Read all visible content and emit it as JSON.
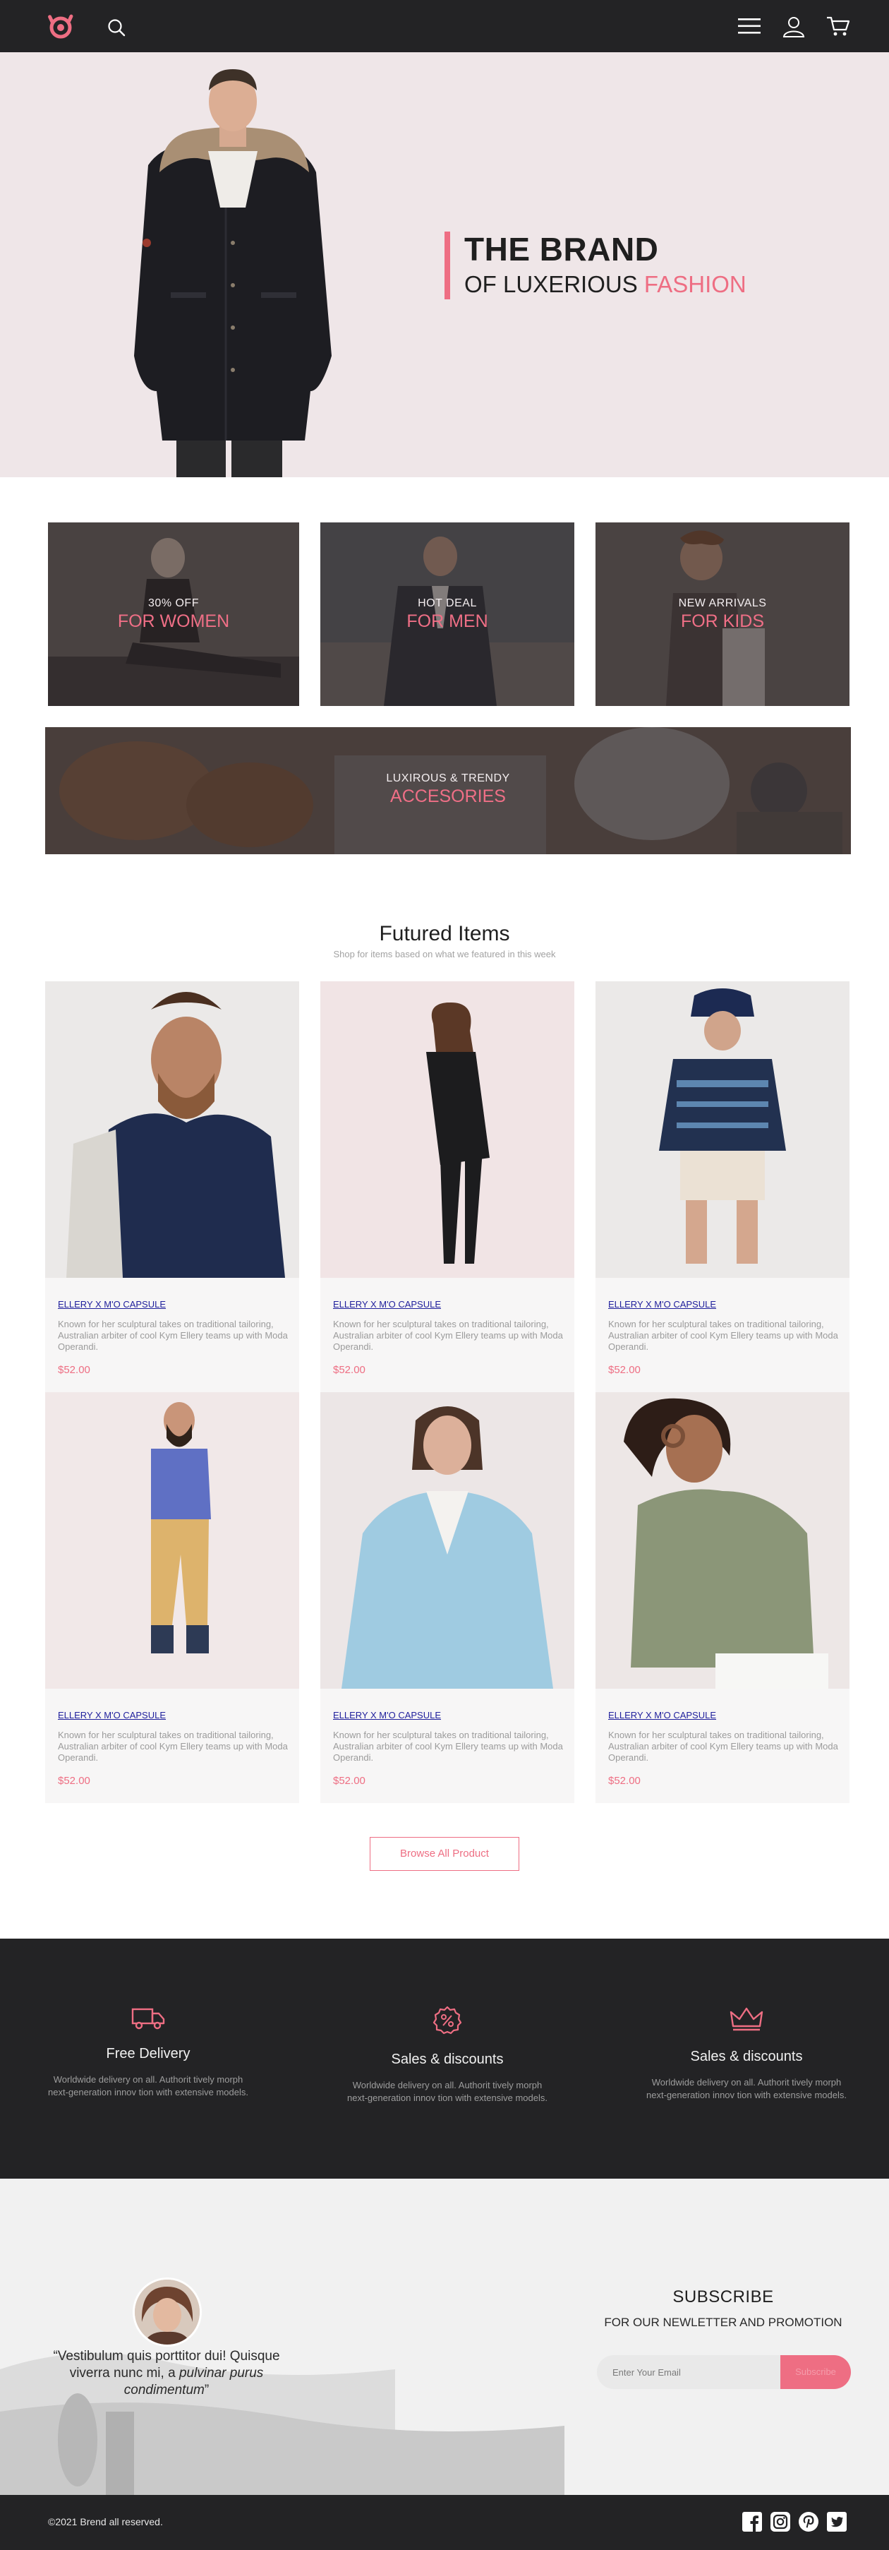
{
  "header": {
    "logo_icon": "brand-hand-logo-icon",
    "search_icon": "search-icon",
    "menu_icon": "hamburger-menu-icon",
    "user_icon": "user-icon",
    "cart_icon": "cart-icon"
  },
  "hero": {
    "title": "THE BRAND",
    "subtitle_prefix": "OF LUXERIOUS ",
    "subtitle_accent": "FASHION"
  },
  "categories": [
    {
      "small": "30% OFF",
      "big": "FOR WOMEN"
    },
    {
      "small": "HOT DEAL",
      "big": "FOR MEN"
    },
    {
      "small": "NEW ARRIVALS",
      "big": "FOR KIDS"
    },
    {
      "small": "LUXIROUS & TRENDY",
      "big": "ACCESORIES"
    }
  ],
  "featured": {
    "title": "Futured Items",
    "subtitle": "Shop for items based on what we featured in this week",
    "products": [
      {
        "brand": "ELLERY X M'O CAPSULE",
        "description": "Known for her sculptural takes on traditional tailoring, Australian arbiter of cool Kym Ellery teams up with Moda Operandi.",
        "price": "$52.00"
      },
      {
        "brand": "ELLERY X M'O CAPSULE",
        "description": "Known for her sculptural takes on traditional tailoring, Australian arbiter of cool Kym Ellery teams up with Moda Operandi.",
        "price": "$52.00"
      },
      {
        "brand": "ELLERY X M'O CAPSULE",
        "description": "Known for her sculptural takes on traditional tailoring, Australian arbiter of cool Kym Ellery teams up with Moda Operandi.",
        "price": "$52.00"
      },
      {
        "brand": "ELLERY X M'O CAPSULE",
        "description": "Known for her sculptural takes on traditional tailoring, Australian arbiter of cool Kym Ellery teams up with Moda Operandi.",
        "price": "$52.00"
      },
      {
        "brand": "ELLERY X M'O CAPSULE",
        "description": "Known for her sculptural takes on traditional tailoring, Australian arbiter of cool Kym Ellery teams up with Moda Operandi.",
        "price": "$52.00"
      },
      {
        "brand": "ELLERY X M'O CAPSULE",
        "description": "Known for her sculptural takes on traditional tailoring, Australian arbiter of cool Kym Ellery teams up with Moda Operandi.",
        "price": "$52.00"
      }
    ],
    "browse_label": "Browse All Product"
  },
  "features": [
    {
      "icon": "delivery-truck-icon",
      "title": "Free Delivery",
      "line1": "Worldwide delivery on all. Authorit tively morph",
      "line2": "next-generation innov tion with extensive models."
    },
    {
      "icon": "percent-discount-icon",
      "title": "Sales & discounts",
      "line1": "Worldwide delivery on all. Authorit tively morph",
      "line2": "next-generation innov tion with extensive models."
    },
    {
      "icon": "crown-icon",
      "title": "Sales & discounts",
      "line1": "Worldwide delivery on all. Authorit tively morph",
      "line2": "next-generation innov tion with extensive models."
    }
  ],
  "testimonial": {
    "quote_part1": "“Vestibulum quis porttitor dui! Quisque viverra nunc mi, a ",
    "quote_italic": "pulvinar purus condimentum",
    "quote_end": "”"
  },
  "subscribe": {
    "title": "SUBSCRIBE",
    "subtitle": "FOR OUR NEWLETTER AND PROMOTION",
    "email_placeholder": "Enter Your Email",
    "button_label": "Subscribe"
  },
  "footer": {
    "copyright": "©2021 Brend all reserved.",
    "social_icons": [
      "facebook-icon",
      "instagram-icon",
      "pinterest-icon",
      "twitter-icon"
    ]
  },
  "colors": {
    "accent": "#ee6e83",
    "dark": "#232325",
    "hero_bg": "#efe6e8"
  }
}
